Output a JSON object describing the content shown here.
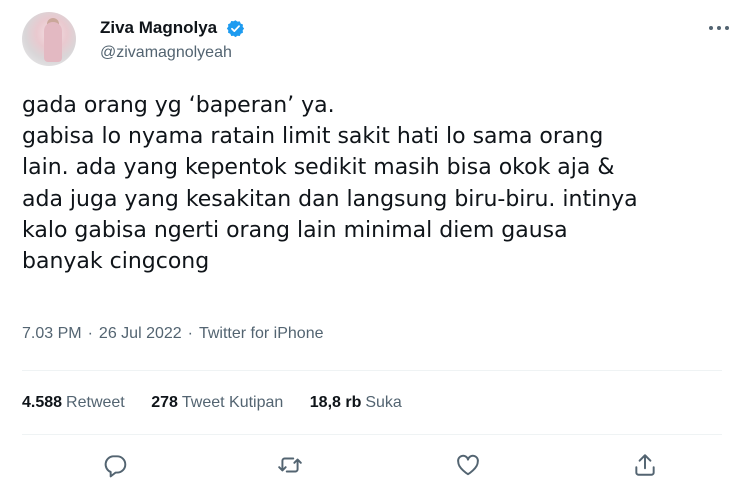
{
  "author": {
    "display_name": "Ziva Magnolya",
    "handle": "@zivamagnolyeah",
    "verified": true,
    "verified_icon": "verified-badge-icon",
    "accent": "#1d9bf0"
  },
  "tweet": {
    "lines": [
      "gada orang yg ‘baperan’ ya.",
      "gabisa lo nyama ratain limit sakit hati lo sama orang",
      "lain. ada yang kepentok sedikit masih bisa okok aja &",
      "ada juga yang kesakitan dan langsung biru-biru. intinya",
      "kalo gabisa ngerti orang lain minimal diem gausa",
      "banyak cingcong"
    ]
  },
  "meta": {
    "time": "7.03 PM",
    "separator": "·",
    "date": "26 Jul 2022",
    "source": "Twitter for iPhone"
  },
  "stats": {
    "retweets": {
      "value": "4.588",
      "label": "Retweet"
    },
    "quotes": {
      "value": "278",
      "label": "Tweet Kutipan"
    },
    "likes": {
      "value": "18,8 rb",
      "label": "Suka"
    }
  },
  "actions": [
    "reply-icon",
    "retweet-icon",
    "like-icon",
    "share-icon"
  ],
  "colors": {
    "text": "#0f1419",
    "secondary": "#536471",
    "divider": "#eff3f4"
  }
}
